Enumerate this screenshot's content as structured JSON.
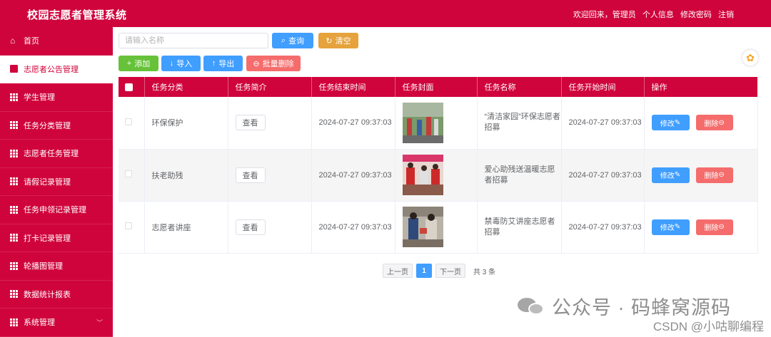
{
  "header": {
    "title": "校园志愿者管理系统",
    "welcome": "欢迎回来，管理员",
    "profile": "个人信息",
    "change_password": "修改密码",
    "logout": "注销"
  },
  "sidebar": {
    "items": [
      {
        "label": "首页",
        "icon": "home-icon"
      },
      {
        "label": "志愿者公告管理",
        "icon": "message-icon"
      },
      {
        "label": "学生管理",
        "icon": "grid-icon"
      },
      {
        "label": "任务分类管理",
        "icon": "grid-icon"
      },
      {
        "label": "志愿者任务管理",
        "icon": "grid-icon"
      },
      {
        "label": "请假记录管理",
        "icon": "grid-icon"
      },
      {
        "label": "任务申领记录管理",
        "icon": "grid-icon"
      },
      {
        "label": "打卡记录管理",
        "icon": "grid-icon"
      },
      {
        "label": "轮播图管理",
        "icon": "grid-icon"
      },
      {
        "label": "数据统计报表",
        "icon": "grid-icon"
      },
      {
        "label": "系统管理",
        "icon": "grid-icon"
      }
    ],
    "active_index": 1
  },
  "search": {
    "placeholder": "请输入名称",
    "query_label": "查询",
    "clear_label": "清空"
  },
  "toolbar": {
    "add_label": "添加",
    "import_label": "导入",
    "export_label": "导出",
    "batch_delete_label": "批量删除"
  },
  "table": {
    "columns": [
      "任务分类",
      "任务简介",
      "任务结束时间",
      "任务封面",
      "任务名称",
      "任务开始时间",
      "操作"
    ],
    "rows": [
      {
        "category": "环保保护",
        "intro": "查看",
        "end_time": "2024-07-27 09:37:03",
        "name": "“清洁家园”环保志愿者招募",
        "start_time": "2024-07-27 09:37:03"
      },
      {
        "category": "扶老助残",
        "intro": "查看",
        "end_time": "2024-07-27 09:37:03",
        "name": "爱心助残送温暖志愿者招募",
        "start_time": "2024-07-27 09:37:03"
      },
      {
        "category": "志愿者讲座",
        "intro": "查看",
        "end_time": "2024-07-27 09:37:03",
        "name": "禁毒防艾讲座志愿者招募",
        "start_time": "2024-07-27 09:37:03"
      }
    ],
    "edit_label": "修改",
    "delete_label": "删除"
  },
  "pagination": {
    "prev": "上一页",
    "current": "1",
    "next": "下一页",
    "total": "共 3 条"
  },
  "watermark": {
    "wechat": "公众号 · 码蜂窝源码",
    "csdn": "CSDN @小咕聊编程"
  },
  "colors": {
    "brand": "#d0043c",
    "primary": "#409eff",
    "success": "#67c23a",
    "warning": "#e6a23c",
    "danger": "#f56c6c"
  }
}
